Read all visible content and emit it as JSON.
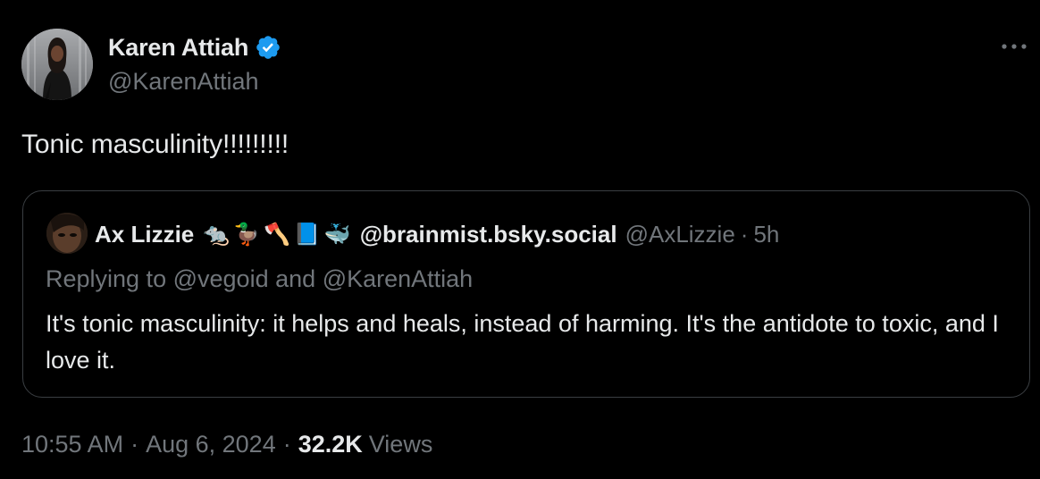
{
  "author": {
    "name": "Karen Attiah",
    "handle": "@KarenAttiah",
    "verified": true
  },
  "tweet": {
    "text": "Tonic masculinity!!!!!!!!!"
  },
  "quote": {
    "name": "Ax Lizzie",
    "emoji_icons": [
      "rat",
      "duck",
      "hammer-axe",
      "book",
      "whale"
    ],
    "emoji_glyphs": [
      "🐀",
      "🦆",
      "🪓",
      "📘",
      "🐳"
    ],
    "bsky": "@brainmist.bsky.social",
    "handle": "@AxLizzie",
    "sep": "·",
    "time": "5h",
    "reply_prefix": "Replying to",
    "reply_to_1": "@vegoid",
    "reply_and": "and",
    "reply_to_2": "@KarenAttiah",
    "text": "It's tonic masculinity: it helps and heals, instead of harming. It's the antidote to toxic, and I love it."
  },
  "meta": {
    "time": "10:55 AM",
    "sep": "·",
    "date": "Aug 6, 2024",
    "views_count": "32.2K",
    "views_label": "Views"
  },
  "colors": {
    "background": "#000000",
    "primary_text": "#e7e9ea",
    "secondary_text": "#71767b",
    "verified_badge": "#1d9bf0",
    "card_border": "#3a3e42"
  }
}
